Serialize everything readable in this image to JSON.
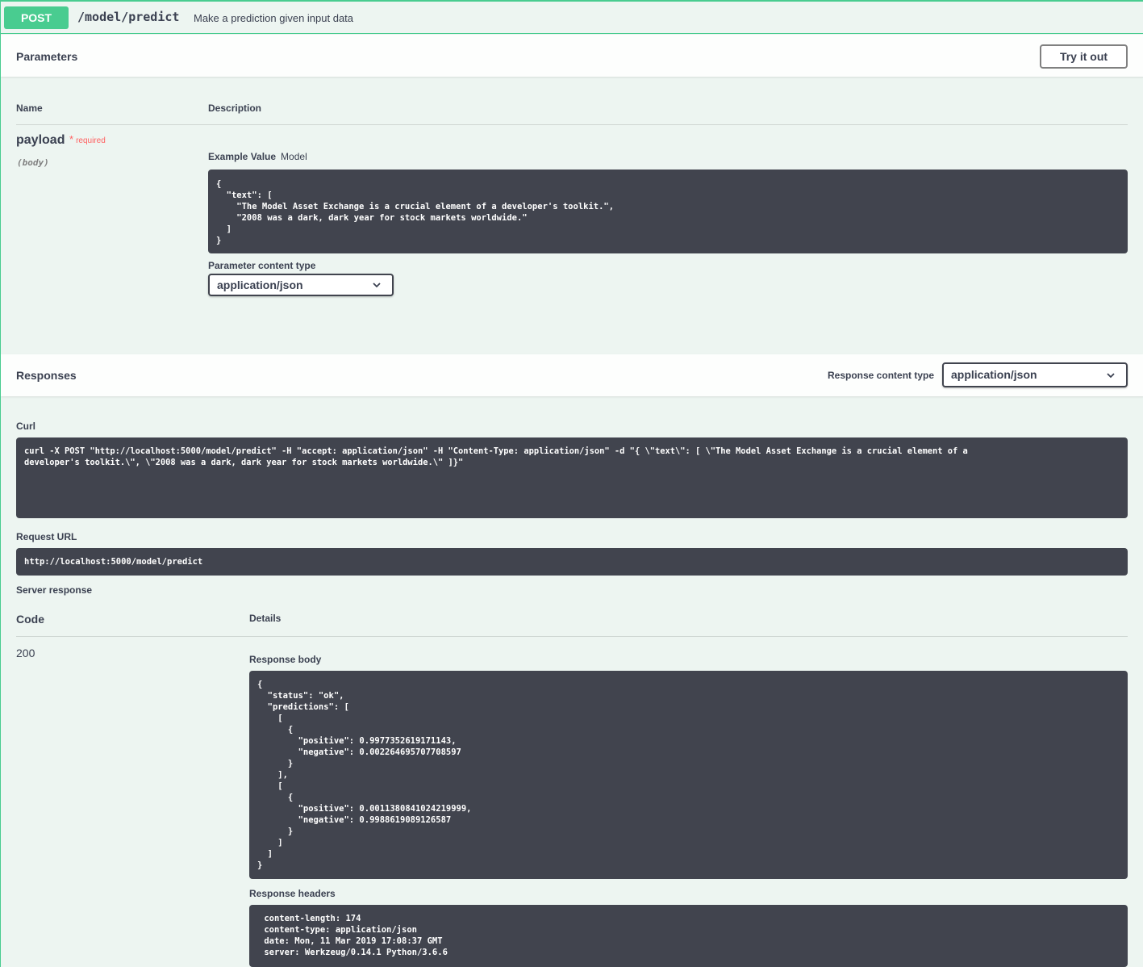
{
  "summary": {
    "method": "POST",
    "path": "/model/predict",
    "description": "Make a prediction given input data"
  },
  "parameters": {
    "title": "Parameters",
    "try_button": "Try it out",
    "col_name": "Name",
    "col_description": "Description",
    "param_name": "payload",
    "required_star": "*",
    "required_label": "required",
    "param_in": "(body)",
    "tab_example": "Example Value",
    "tab_model": "Model",
    "example_value": "{\n  \"text\": [\n    \"The Model Asset Exchange is a crucial element of a developer's toolkit.\",\n    \"2008 was a dark, dark year for stock markets worldwide.\"\n  ]\n}",
    "content_type_label": "Parameter content type",
    "content_type_value": "application/json"
  },
  "responses": {
    "title": "Responses",
    "content_type_label": "Response content type",
    "content_type_value": "application/json",
    "curl_label": "Curl",
    "curl": "curl -X POST \"http://localhost:5000/model/predict\" -H \"accept: application/json\" -H \"Content-Type: application/json\" -d \"{ \\\"text\\\": [ \\\"The Model Asset Exchange is a crucial element of a\ndeveloper's toolkit.\\\", \\\"2008 was a dark, dark year for stock markets worldwide.\\\" ]}\"",
    "request_url_label": "Request URL",
    "request_url": "http://localhost:5000/model/predict",
    "server_response_label": "Server response",
    "col_code": "Code",
    "col_details": "Details",
    "status_code": "200",
    "response_body_label": "Response body",
    "response_body": "{\n  \"status\": \"ok\",\n  \"predictions\": [\n    [\n      {\n        \"positive\": 0.9977352619171143,\n        \"negative\": 0.002264695707708597\n      }\n    ],\n    [\n      {\n        \"positive\": 0.0011380841024219999,\n        \"negative\": 0.9988619089126587\n      }\n    ]\n  ]\n}",
    "response_headers_label": "Response headers",
    "response_headers": " content-length: 174\n content-type: application/json\n date: Mon, 11 Mar 2019 17:08:37 GMT\n server: Werkzeug/0.14.1 Python/3.6.6"
  },
  "colors": {
    "accent": "#49cc90",
    "background": "#edf5f1",
    "code_bg": "#41444e",
    "required": "#ff6060"
  },
  "icons": [
    "chevron-down-icon"
  ]
}
